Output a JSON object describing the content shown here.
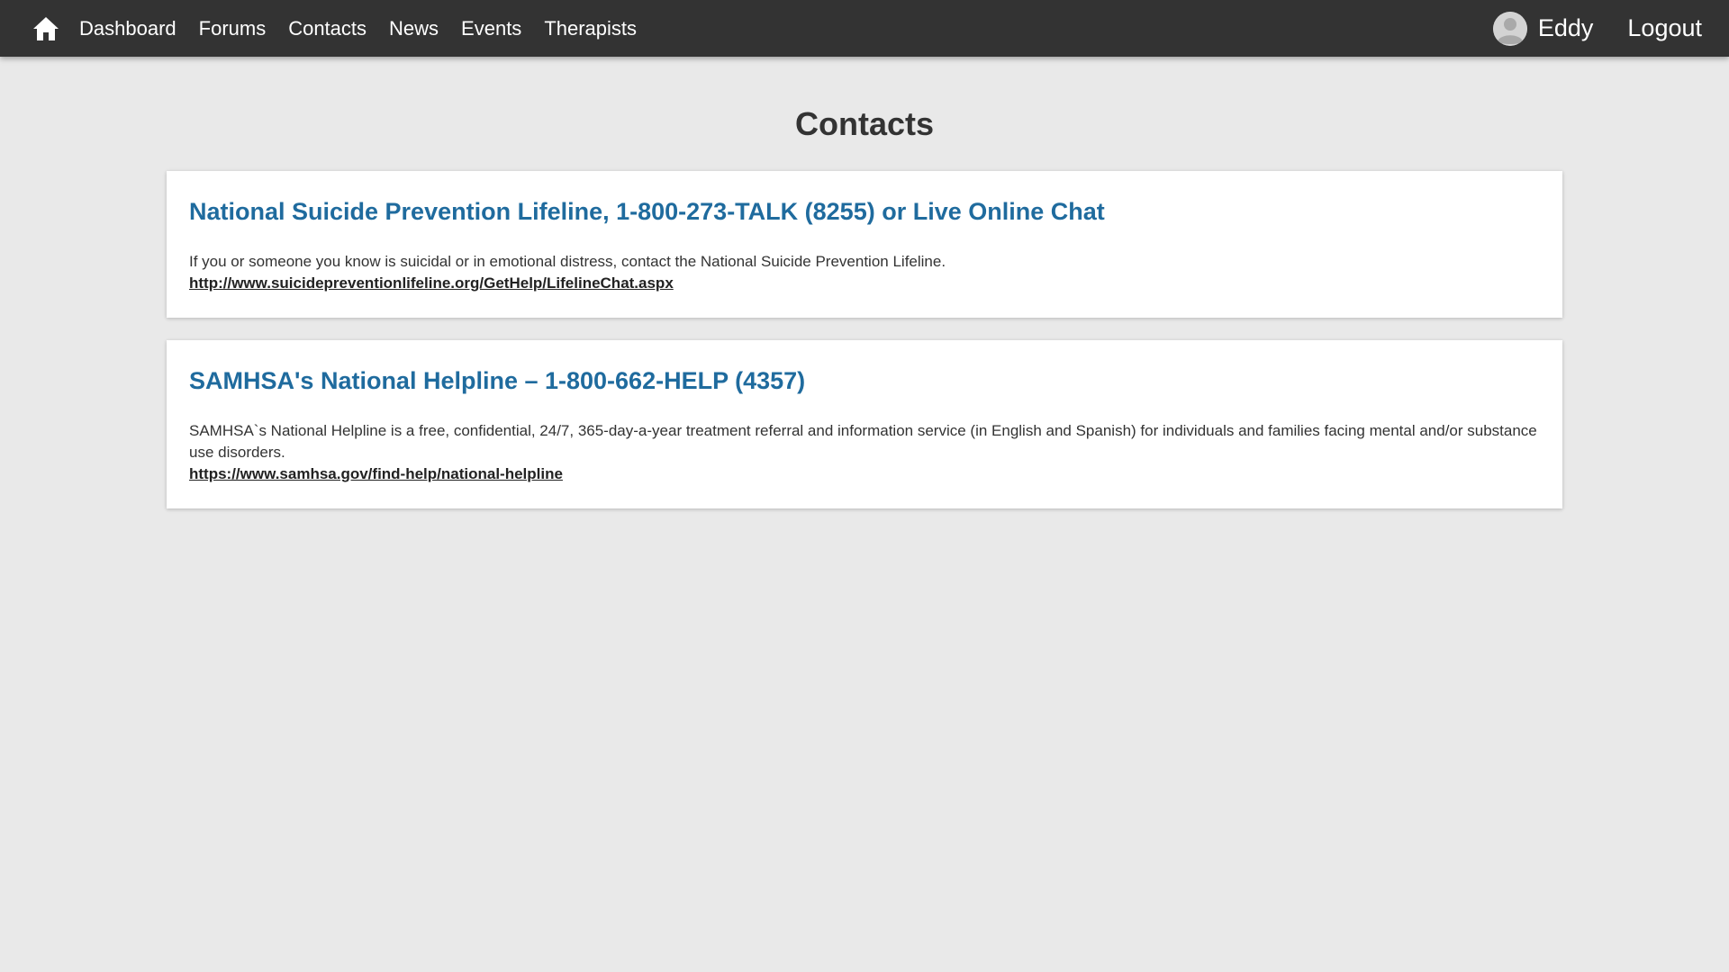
{
  "nav": {
    "home_icon": "home-icon",
    "links": [
      "Dashboard",
      "Forums",
      "Contacts",
      "News",
      "Events",
      "Therapists"
    ],
    "user_name": "Eddy",
    "logout_label": "Logout",
    "avatar_icon": "user-avatar-icon"
  },
  "page": {
    "title": "Contacts"
  },
  "contacts": [
    {
      "title": "National Suicide Prevention Lifeline, 1-800-273-TALK (8255) or Live Online Chat",
      "description": "If you or someone you know is suicidal or in emotional distress, contact the National Suicide Prevention Lifeline.",
      "url": "http://www.suicidepreventionlifeline.org/GetHelp/LifelineChat.aspx"
    },
    {
      "title": "SAMHSA's National Helpline – 1-800-662-HELP (4357)",
      "description": "SAMHSA`s National Helpline is a free, confidential, 24/7, 365-day-a-year treatment referral and information service (in English and Spanish) for individuals and families facing mental and/or substance use disorders.",
      "url": "https://www.samhsa.gov/find-help/national-helpline"
    }
  ],
  "colors": {
    "navbar": "#333333",
    "background": "#e9e9e9",
    "card_title": "#1f6b9e"
  }
}
